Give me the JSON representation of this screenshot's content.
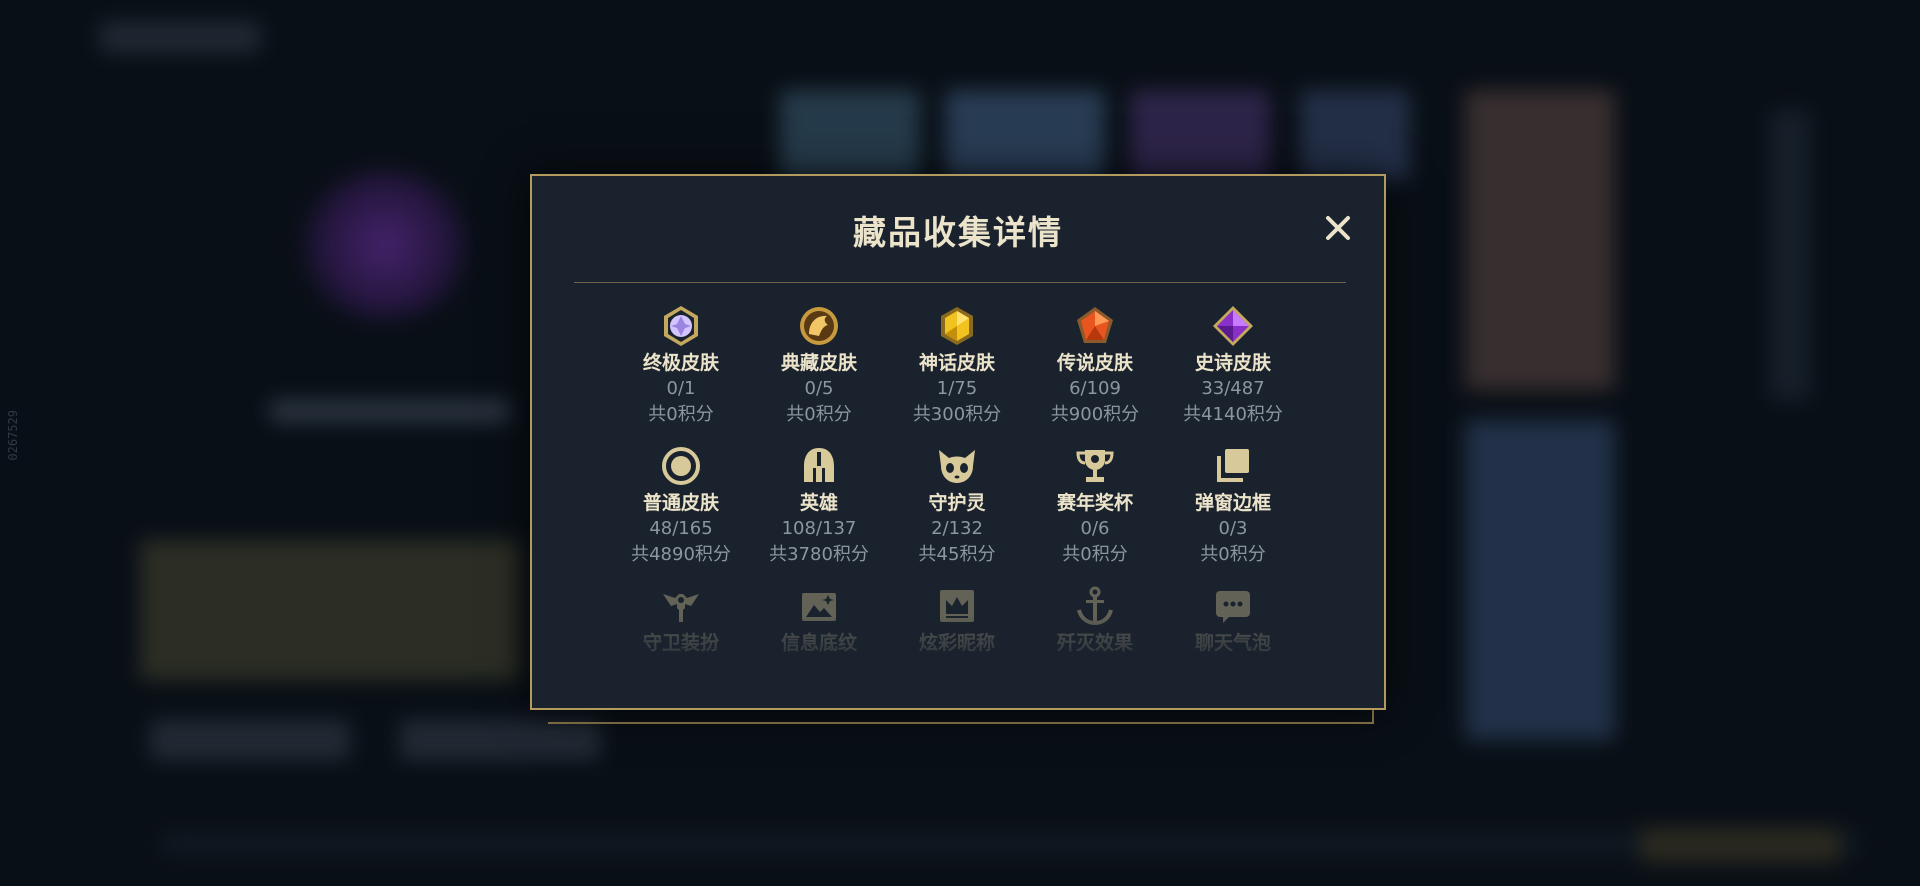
{
  "background": {
    "side_code": "0267529"
  },
  "modal": {
    "title": "藏品收集详情",
    "close_label": "✕",
    "items": [
      {
        "label": "终极皮肤",
        "count": "0/1",
        "points": "共0积分",
        "icon": "ultimate-skin-icon"
      },
      {
        "label": "典藏皮肤",
        "count": "0/5",
        "points": "共0积分",
        "icon": "prestige-skin-icon"
      },
      {
        "label": "神话皮肤",
        "count": "1/75",
        "points": "共300积分",
        "icon": "mythic-skin-icon"
      },
      {
        "label": "传说皮肤",
        "count": "6/109",
        "points": "共900积分",
        "icon": "legendary-skin-icon"
      },
      {
        "label": "史诗皮肤",
        "count": "33/487",
        "points": "共4140积分",
        "icon": "epic-skin-icon"
      },
      {
        "label": "普通皮肤",
        "count": "48/165",
        "points": "共4890积分",
        "icon": "standard-skin-icon"
      },
      {
        "label": "英雄",
        "count": "108/137",
        "points": "共3780积分",
        "icon": "champion-helmet-icon"
      },
      {
        "label": "守护灵",
        "count": "2/132",
        "points": "共45积分",
        "icon": "companion-icon"
      },
      {
        "label": "赛年奖杯",
        "count": "0/6",
        "points": "共0积分",
        "icon": "trophy-icon"
      },
      {
        "label": "弹窗边框",
        "count": "0/3",
        "points": "共0积分",
        "icon": "popup-frame-icon"
      },
      {
        "label": "守卫装扮",
        "icon": "ward-skin-icon"
      },
      {
        "label": "信息底纹",
        "icon": "banner-icon"
      },
      {
        "label": "炫彩昵称",
        "icon": "nickname-crown-icon"
      },
      {
        "label": "歼灭效果",
        "icon": "finisher-anchor-icon"
      },
      {
        "label": "聊天气泡",
        "icon": "chat-bubble-icon"
      }
    ]
  },
  "colors": {
    "modal_border": "#b39a5d",
    "modal_bg": "#1a232d",
    "title": "#ece3cb",
    "secondary_text": "#8b96a0",
    "icon_gold": "#d8c99a"
  }
}
